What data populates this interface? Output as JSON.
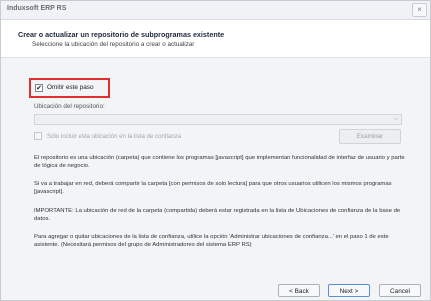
{
  "window": {
    "title": "Induxsoft ERP RS",
    "close_glyph": "×"
  },
  "header": {
    "title": "Crear o actualizar un repositorio de subprogramas existente",
    "subtitle": "Seleccione la ubicación del repositorio a crear o actualizar"
  },
  "form": {
    "omit_step": {
      "label": "Omitir este paso",
      "checked": true,
      "check_glyph": "✔"
    },
    "repo_label": "Ubicación del repositorio:",
    "repo_value": "",
    "repo_arrow": "⌵",
    "trust_label": "Sólo incluir esta ubicación en la lista de confianza",
    "browse_label": "Examinar"
  },
  "paragraphs": {
    "p1": "El repositorio es una ubicación (carpeta) que contiene los programas [javascript] que implementan funcionalidad de interfaz de usuario y parte de lógica de negocio.",
    "p2": "Si va a trabajar en red, deberá compartir la carpeta [con permisos de solo lectura] para que otros usuarios utilicen los mismos programas [javascript].",
    "p3": "IMPORTANTE: La ubicación de red de la carpeta (compartida) deberá estar registrada en la lista de Ubicaciones de confianza de la base de datos.",
    "p4": "Para agregar o quitar ubicaciones de la lista de confianza, utilice la opción 'Administrar ubicaciones de confianza...' en el paso 1 de este asistente. (Necesitará permisos del grupo de Administradores del sistema ERP RS)"
  },
  "buttons": {
    "back": "< Back",
    "next": "Next >",
    "cancel": "Cancel"
  }
}
